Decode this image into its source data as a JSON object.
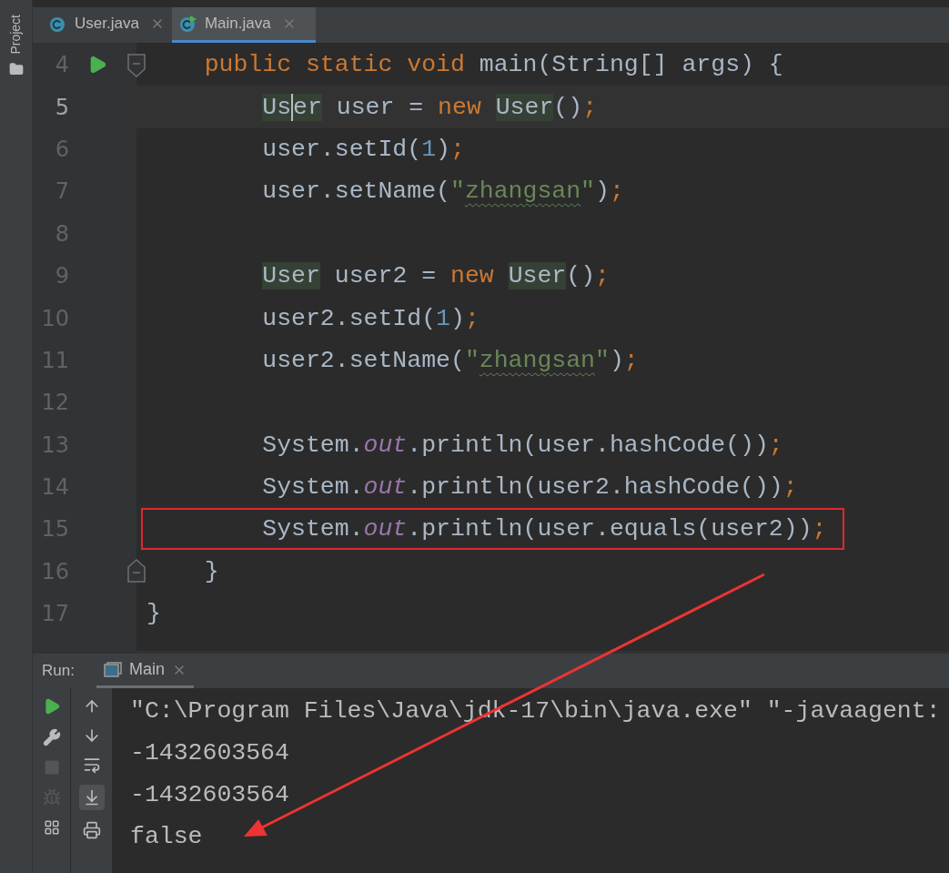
{
  "side_panel": {
    "label": "Project"
  },
  "tabs": [
    {
      "label": "User.java",
      "selected": false,
      "kind": "class"
    },
    {
      "label": "Main.java",
      "selected": true,
      "kind": "main-class"
    }
  ],
  "editor": {
    "lines": [
      {
        "number": "4",
        "run": true,
        "fold_start": true,
        "current": false,
        "boxed": false,
        "tokens": [
          {
            "t": "    public static void ",
            "kind": "keyword"
          },
          {
            "t": "main(String[] args) {",
            "kind": "plain"
          }
        ]
      },
      {
        "number": "5",
        "current": true,
        "boxed": false,
        "tokens": [
          {
            "t": "        Us",
            "kind": "usage",
            "caret": true
          },
          {
            "t": "er",
            "kind": "usage"
          },
          {
            "t": " user = ",
            "kind": "plain"
          },
          {
            "t": "new ",
            "kind": "keyword"
          },
          {
            "t": "User",
            "kind": "usage"
          },
          {
            "t": "()",
            "kind": "plain"
          },
          {
            "t": ";",
            "kind": "keyword"
          }
        ]
      },
      {
        "number": "6",
        "current": false,
        "boxed": false,
        "tokens": [
          {
            "t": "        user.setId(",
            "kind": "plain"
          },
          {
            "t": "1",
            "kind": "number"
          },
          {
            "t": ")",
            "kind": "plain"
          },
          {
            "t": ";",
            "kind": "keyword"
          }
        ]
      },
      {
        "number": "7",
        "current": false,
        "boxed": false,
        "tokens": [
          {
            "t": "        user.setName(",
            "kind": "plain"
          },
          {
            "t": "\"",
            "kind": "string"
          },
          {
            "t": "zhangsan",
            "kind": "string",
            "typo": true
          },
          {
            "t": "\"",
            "kind": "string"
          },
          {
            "t": ")",
            "kind": "plain"
          },
          {
            "t": ";",
            "kind": "keyword"
          }
        ]
      },
      {
        "number": "8",
        "current": false
      },
      {
        "number": "9",
        "current": false,
        "boxed": false,
        "tokens": [
          {
            "t": "        User",
            "kind": "usage"
          },
          {
            "t": " user2 = ",
            "kind": "plain"
          },
          {
            "t": "new ",
            "kind": "keyword"
          },
          {
            "t": "User",
            "kind": "usage"
          },
          {
            "t": "()",
            "kind": "plain"
          },
          {
            "t": ";",
            "kind": "keyword"
          }
        ]
      },
      {
        "number": "10",
        "current": false,
        "boxed": false,
        "tokens": [
          {
            "t": "        user2.setId(",
            "kind": "plain"
          },
          {
            "t": "1",
            "kind": "number"
          },
          {
            "t": ")",
            "kind": "plain"
          },
          {
            "t": ";",
            "kind": "keyword"
          }
        ]
      },
      {
        "number": "11",
        "current": false,
        "boxed": false,
        "tokens": [
          {
            "t": "        user2.setName(",
            "kind": "plain"
          },
          {
            "t": "\"",
            "kind": "string"
          },
          {
            "t": "zhangsan",
            "kind": "string",
            "typo": true
          },
          {
            "t": "\"",
            "kind": "string"
          },
          {
            "t": ")",
            "kind": "plain"
          },
          {
            "t": ";",
            "kind": "keyword"
          }
        ]
      },
      {
        "number": "12",
        "current": false
      },
      {
        "number": "13",
        "current": false,
        "boxed": false,
        "tokens": [
          {
            "t": "        System.",
            "kind": "plain"
          },
          {
            "t": "out",
            "kind": "field"
          },
          {
            "t": ".println(user.hashCode())",
            "kind": "plain"
          },
          {
            "t": ";",
            "kind": "keyword"
          }
        ]
      },
      {
        "number": "14",
        "current": false,
        "boxed": false,
        "tokens": [
          {
            "t": "        System.",
            "kind": "plain"
          },
          {
            "t": "out",
            "kind": "field"
          },
          {
            "t": ".println(user2.hashCode())",
            "kind": "plain"
          },
          {
            "t": ";",
            "kind": "keyword"
          }
        ]
      },
      {
        "number": "15",
        "current": false,
        "boxed": true,
        "tokens": [
          {
            "t": "        System.",
            "kind": "plain"
          },
          {
            "t": "out",
            "kind": "field"
          },
          {
            "t": ".println(user.equals(user2))",
            "kind": "plain"
          },
          {
            "t": ";",
            "kind": "keyword"
          }
        ]
      },
      {
        "number": "16",
        "fold_end": true,
        "current": false,
        "boxed": false,
        "tokens": [
          {
            "t": "    }",
            "kind": "plain"
          }
        ]
      },
      {
        "number": "17",
        "current": false,
        "boxed": false,
        "tokens": [
          {
            "t": "}",
            "kind": "plain"
          }
        ]
      }
    ]
  },
  "run_panel": {
    "title": "Run:",
    "tab": {
      "label": "Main",
      "selected": true
    },
    "console": [
      "\"C:\\Program Files\\Java\\jdk-17\\bin\\java.exe\" \"-javaagent:",
      "-1432603564",
      "-1432603564",
      "false"
    ]
  }
}
